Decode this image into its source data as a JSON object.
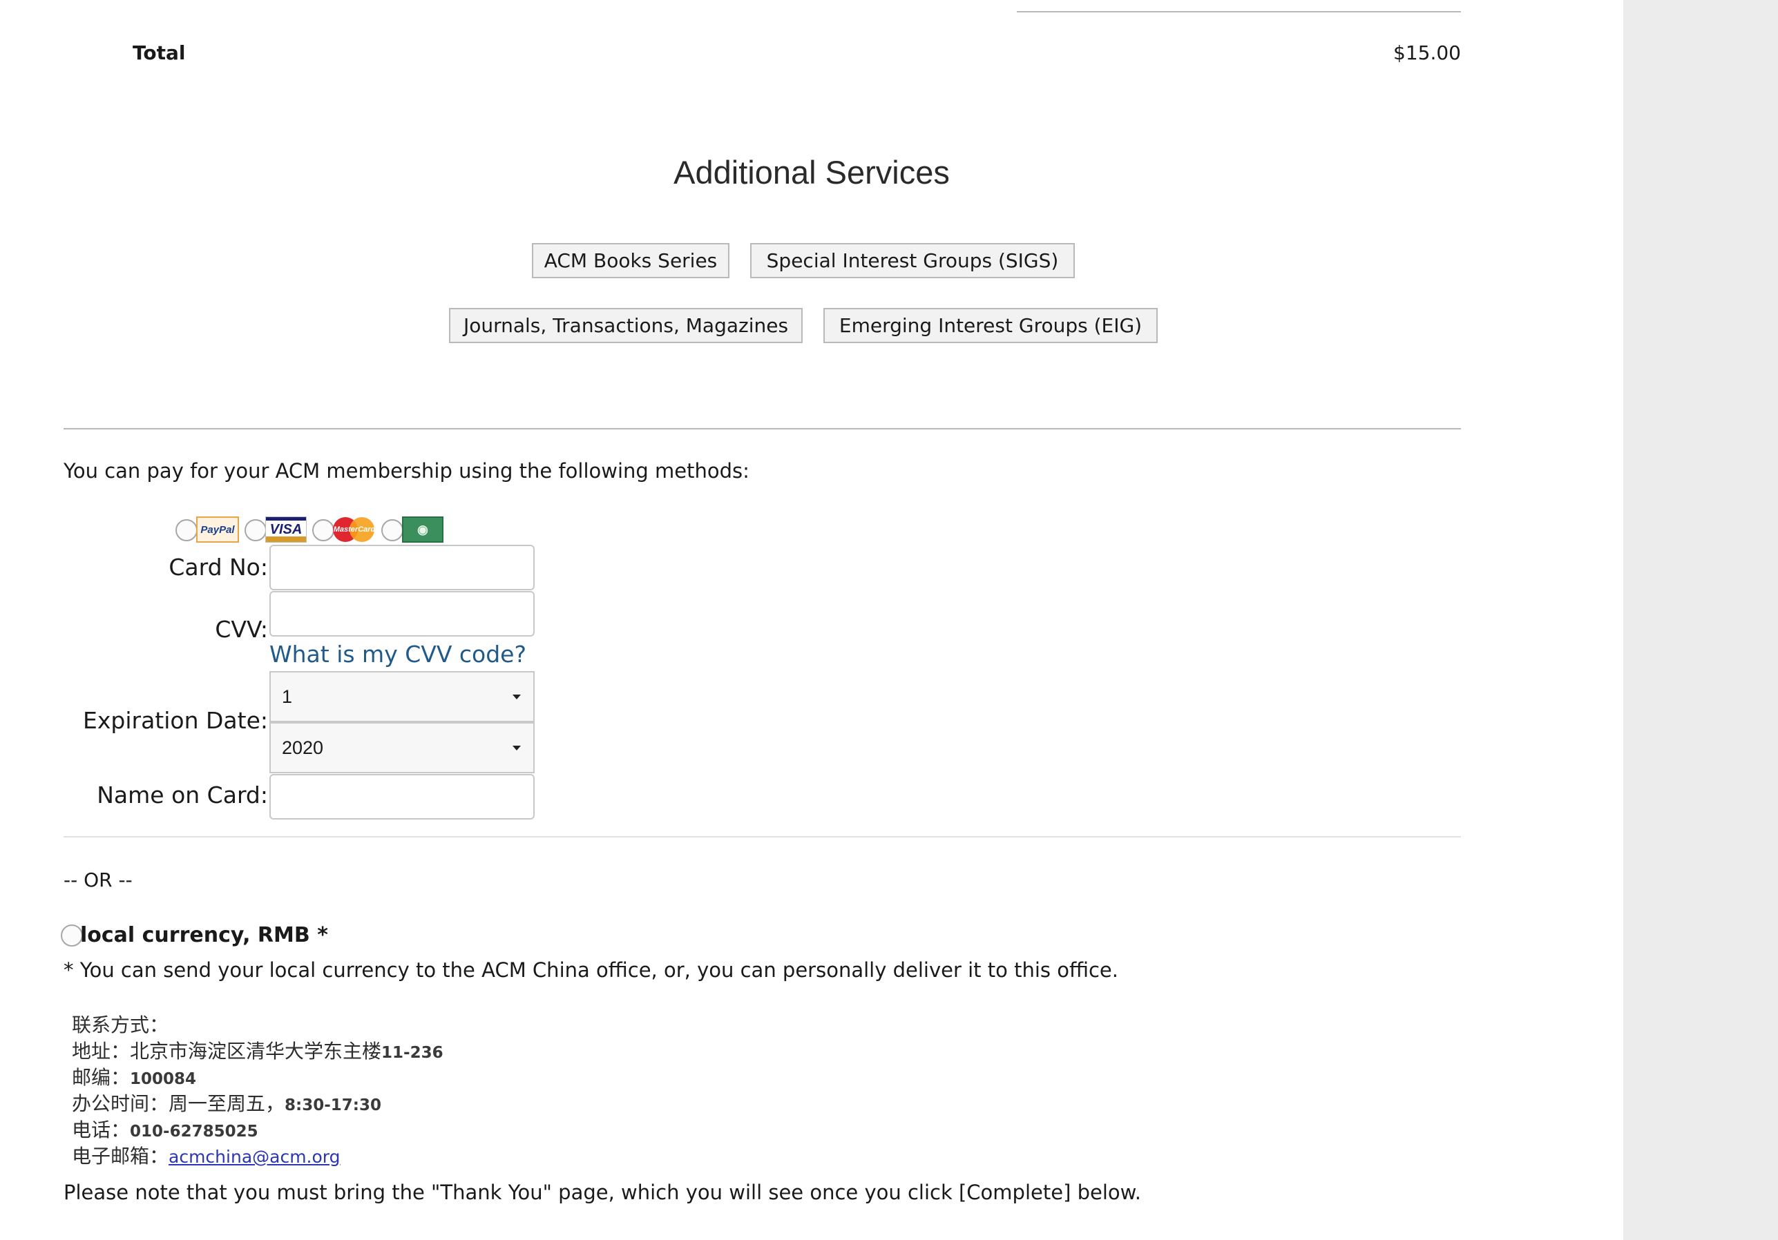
{
  "summary": {
    "total_label": "Total",
    "total_value": "$15.00"
  },
  "additional_services": {
    "title": "Additional Services",
    "buttons": {
      "books": "ACM Books Series",
      "sigs": "Special Interest Groups (SIGS)",
      "journals": "Journals, Transactions, Magazines",
      "eig": "Emerging Interest Groups (EIG)"
    }
  },
  "payment": {
    "intro": "You can pay for your ACM membership using the following methods:",
    "methods": {
      "paypal": "PayPal",
      "visa": "VISA",
      "mastercard": "MasterCard",
      "amex": "AMEX"
    },
    "card_no_label": "Card No:",
    "cvv_label": "CVV:",
    "cvv_link": "What is my CVV code?",
    "expiration_label": "Expiration Date:",
    "exp_month": "1",
    "exp_year": "2020",
    "name_label": "Name on Card:",
    "card_no_value": "",
    "cvv_value": "",
    "name_value": ""
  },
  "alternative": {
    "or_text": "-- OR --",
    "rmb_label": "local currency, RMB *",
    "note": "* You can send your local currency to the ACM China office, or, you can personally deliver it to this office.",
    "contact": {
      "heading": "联系方式：",
      "address_key": "地址：北京市海淀区清华大学东主楼",
      "address_val": "11-236",
      "postcode_key": "邮编：",
      "postcode_val": "100084",
      "hours_key": "办公时间：周一至周五，",
      "hours_val": "8:30-17:30",
      "phone_key": "电话：",
      "phone_val": "010-62785025",
      "email_key": "电子邮箱：",
      "email_val": "acmchina@acm.org"
    },
    "bring_note": "Please note that you must bring the \"Thank You\" page, which you will see once you click [Complete] below."
  },
  "colors": {
    "link": "#1f5a8a",
    "email_link": "#2b36b7",
    "side_panel": "#ececec"
  }
}
